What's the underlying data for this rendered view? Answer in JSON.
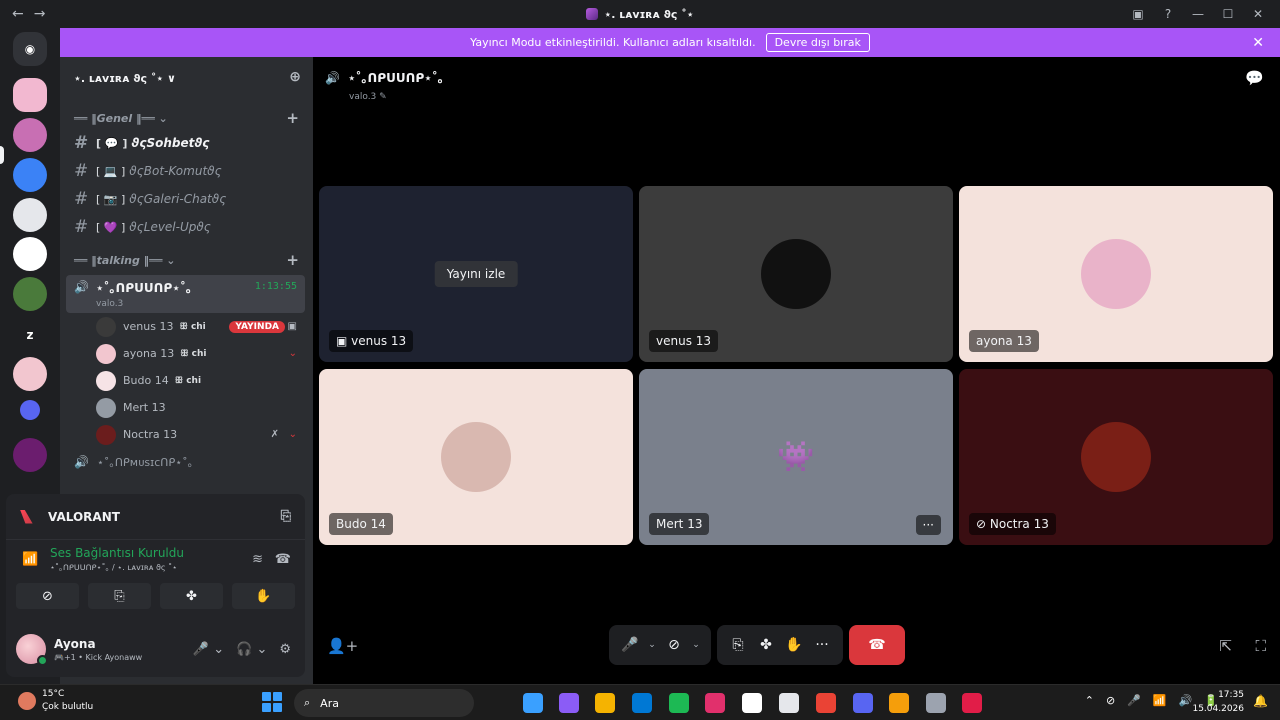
{
  "titlebar": {
    "title": "⋆. ʟᴀᴠɪʀᴀ ϑ⁢ς ˚⋆",
    "back": "←",
    "forward": "→",
    "icons": [
      "inbox-icon",
      "help-icon",
      "minimize-icon",
      "maximize-icon",
      "close-icon"
    ],
    "icon_glyphs": [
      "▣",
      "?",
      "—",
      "☐",
      "✕"
    ]
  },
  "banner": {
    "text": "Yayıncı Modu etkinleştirildi. Kullanıcı adları kısaltıldı.",
    "button": "Devre dışı bırak",
    "close": "✕"
  },
  "servers": {
    "home_glyph": "◉",
    "letter_server": "z",
    "colors": [
      "#f2b8d0",
      "#c86fb3",
      "#3b82f6",
      "#e5e7eb",
      "#ffffff",
      "#4a7a3b",
      "#1e1f22",
      "#f2c6cf",
      "#5865f2",
      "#6b1d6e"
    ]
  },
  "guild": {
    "name": "⋆. ʟᴀᴠɪʀᴀ ϑ⁢ς ˚⋆ ∨",
    "categories": [
      {
        "label": "══ ‖Genel ‖══ ⌄",
        "plus": "+",
        "channels": [
          {
            "hash": "#",
            "emoji": "[ 💬 ]",
            "name": "ϑ⁢ςSohbetϑ⁢ς",
            "active": true
          },
          {
            "hash": "#",
            "emoji": "[ 💻 ]",
            "name": "ϑ⁢ςBot-Komutϑ⁢ς",
            "active": false
          },
          {
            "hash": "#",
            "emoji": "[ 📷 ]",
            "name": "ϑ⁢ςGaleri-Chatϑ⁢ς",
            "active": false
          },
          {
            "hash": "#",
            "emoji": "[ 💜 ]",
            "name": "ϑ⁢ςLevel-Upϑ⁢ς",
            "active": false
          }
        ]
      },
      {
        "label": "══ ‖talking ‖══ ⌄",
        "plus": "+"
      }
    ],
    "voice_channel": {
      "name": "⋆˚｡ᑎᑭᑌᑌᑎᑭ⋆˚｡",
      "sub": "valo.3",
      "time": "1:13:55",
      "speaker": "🔊"
    },
    "members": [
      {
        "name": "venus 13",
        "tag": "ꕥ chi",
        "live": "YAYINDA",
        "icon": "▣",
        "color": "#3a3a3a"
      },
      {
        "name": "ayona 13",
        "tag": "ꕥ chi",
        "icon": "⌄",
        "color": "#f2c6cf"
      },
      {
        "name": "Budo 14",
        "tag": "ꕥ chi",
        "color": "#f6e3e6"
      },
      {
        "name": "Mert 13",
        "color": "#949ba4"
      },
      {
        "name": "Noctra 13",
        "icon": "⌄",
        "icon2": "✗",
        "color": "#6b1d1d"
      }
    ],
    "voice_channel2": "⋆˚｡ᑎᑭᴍᴜsɪᴄᑎᑭ⋆˚｡"
  },
  "panel": {
    "activity": "VALORANT",
    "connection_title": "Ses Bağlantısı Kuruldu",
    "connection_sub": "⋆˚｡ᑎᑭᑌᑌᑎᑭ⋆˚｡ / ⋆. ʟᴀᴠɪʀᴀ ϑ⁢ς ˚⋆",
    "conn_icon": "📶",
    "noise_icon": "≋",
    "disconnect_icon": "☎",
    "actions": [
      "⊘",
      "⎘",
      "✤",
      "✋"
    ],
    "user": {
      "name": "Ayona",
      "status": "🎮+1 • Kick Ayonaww",
      "mic": "🎤 ⌄",
      "headset": "🎧 ⌄",
      "settings": "⚙"
    }
  },
  "stage": {
    "channel": "⋆˚｡ᑎᑭᑌᑌᑎᑭ⋆˚｡",
    "sub": "valo.3 ✎",
    "speaker": "🔊",
    "chat_icon": "💬",
    "watch": "Yayını izle",
    "tiles": [
      {
        "label": "▣ venus 13",
        "bg": "#1e2230"
      },
      {
        "label": "venus 13",
        "bg": "#3c3c3c",
        "av": "#111111"
      },
      {
        "label": "ayona 13",
        "bg": "#f4e2dc",
        "av": "#e9b3c9"
      },
      {
        "label": "Budo 14",
        "bg": "#f4e2dc",
        "av": "#d9b8b0"
      },
      {
        "label": "Mert 13",
        "bg": "#7a808c",
        "more": "···",
        "discord": "👾"
      },
      {
        "label": "⊘ Noctra 13",
        "bg": "#3a0e12",
        "av": "#7a1f16"
      }
    ],
    "controls": {
      "mic": "🎤",
      "chev": "⌄",
      "cam": "⊘",
      "screen": "⎘",
      "activity": "✤",
      "soundboard": "✋",
      "more": "···",
      "hangup": "☎"
    },
    "invite_icon": "👤+",
    "popout_icon": "⇱",
    "fullscreen_icon": "⛶"
  },
  "taskbar": {
    "temp": "15°C",
    "weather": "Çok bulutlu",
    "search": "Ara",
    "search_glyph": "⌕",
    "time": "17:35",
    "date": "15.04.2026",
    "tray": [
      "⌃",
      "⊘",
      "🎤",
      "📶",
      "🔊",
      "🔋"
    ],
    "bell": "🔔",
    "apps": [
      "#3aa0ff",
      "#8b5cf6",
      "#f5b301",
      "#0078d4",
      "#1db954",
      "#e1306c",
      "#ffffff",
      "#e5e7eb",
      "#ea4335",
      "#5865f2",
      "#f59e0b",
      "#9ca3af",
      "#e11d48"
    ]
  }
}
